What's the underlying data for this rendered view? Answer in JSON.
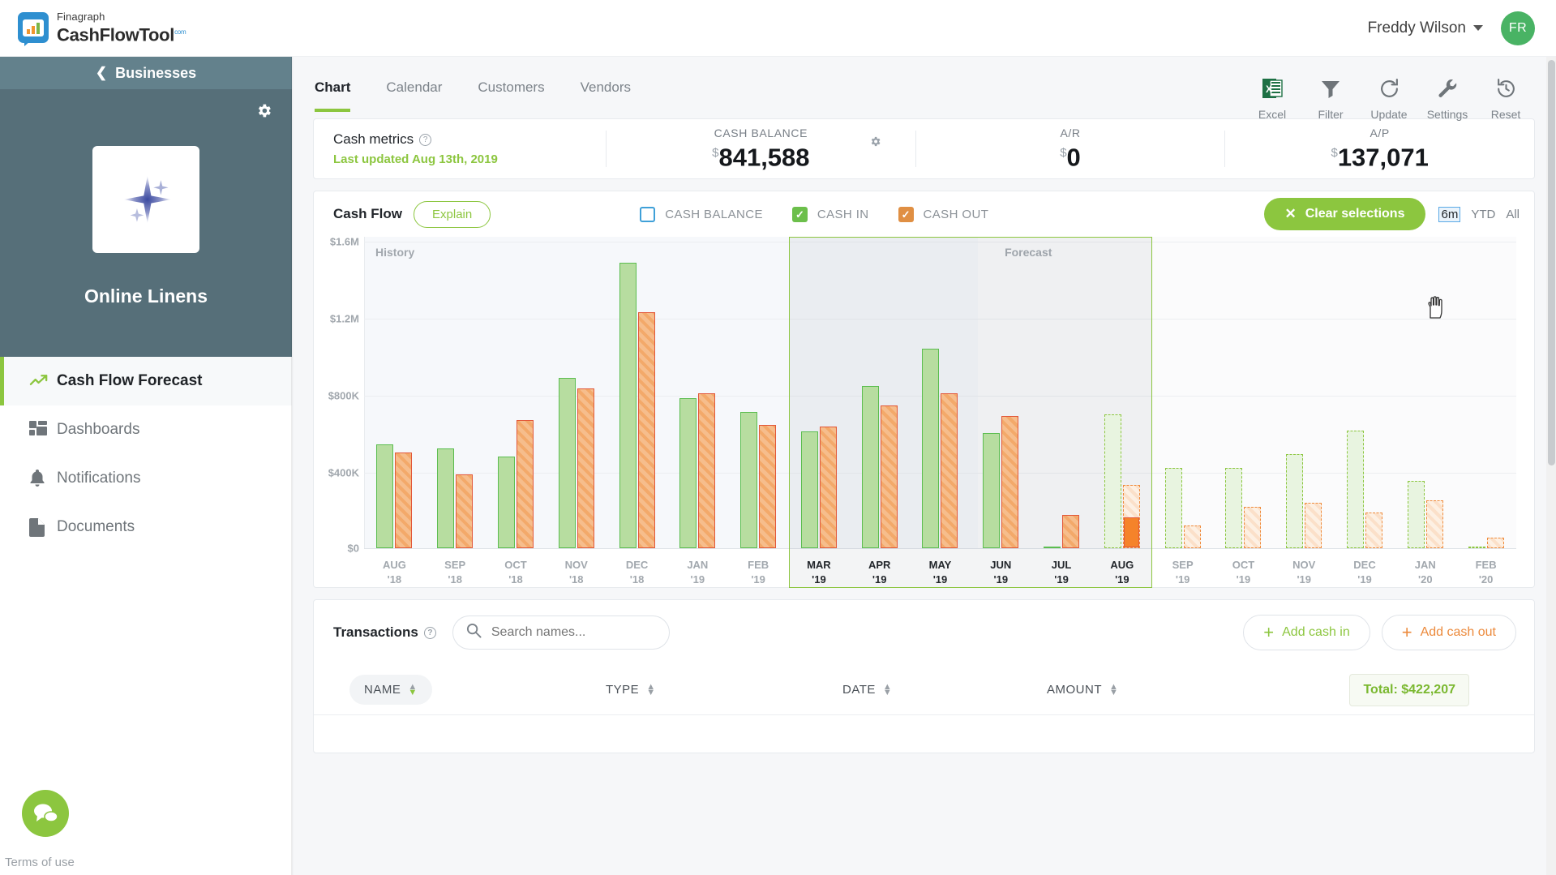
{
  "topbar": {
    "logo_top": "Finagraph",
    "logo_main": "CashFlowTool",
    "logo_sup": "com",
    "user_name": "Freddy Wilson",
    "avatar_initials": "FR"
  },
  "sidebar": {
    "businesses_label": "Businesses",
    "business_name": "Online Linens",
    "items": [
      {
        "label": "Cash Flow Forecast",
        "icon": "trend-up-icon",
        "active": true
      },
      {
        "label": "Dashboards",
        "icon": "dashboard-grid-icon",
        "active": false
      },
      {
        "label": "Notifications",
        "icon": "bell-icon",
        "active": false
      },
      {
        "label": "Documents",
        "icon": "document-icon",
        "active": false
      }
    ],
    "terms_label": "Terms of use"
  },
  "tabs": [
    {
      "label": "Chart",
      "active": true
    },
    {
      "label": "Calendar",
      "active": false
    },
    {
      "label": "Customers",
      "active": false
    },
    {
      "label": "Vendors",
      "active": false
    }
  ],
  "toolbar": [
    {
      "label": "Excel",
      "icon": "excel-icon"
    },
    {
      "label": "Filter",
      "icon": "funnel-icon"
    },
    {
      "label": "Update",
      "icon": "refresh-icon"
    },
    {
      "label": "Settings",
      "icon": "wrench-icon"
    },
    {
      "label": "Reset",
      "icon": "history-icon"
    }
  ],
  "metrics": {
    "title": "Cash metrics",
    "last_updated": "Last updated Aug 13th, 2019",
    "cards": [
      {
        "label": "CASH BALANCE",
        "currency": "$",
        "value": "841,588"
      },
      {
        "label": "A/R",
        "currency": "$",
        "value": "0"
      },
      {
        "label": "A/P",
        "currency": "$",
        "value": "137,071"
      }
    ]
  },
  "cashflow": {
    "title": "Cash Flow",
    "explain_label": "Explain",
    "legend": [
      {
        "label": "CASH BALANCE",
        "checked": false,
        "color": "#3fa0d8"
      },
      {
        "label": "CASH IN",
        "checked": true,
        "color": "#6cbf4b"
      },
      {
        "label": "CASH OUT",
        "checked": true,
        "color": "#e08f43"
      }
    ],
    "clear_label": "Clear selections",
    "ranges": [
      {
        "label": "6m",
        "selected": true
      },
      {
        "label": "YTD",
        "selected": false
      },
      {
        "label": "All",
        "selected": false
      }
    ],
    "history_label": "History",
    "forecast_label": "Forecast"
  },
  "chart_data": {
    "type": "bar",
    "title": "Cash Flow",
    "xlabel": "",
    "ylabel": "",
    "ylim": [
      0,
      1600000
    ],
    "yticks": [
      0,
      400000,
      800000,
      1200000,
      1600000
    ],
    "ytick_labels": [
      "$0",
      "$400K",
      "$800K",
      "$1.2M",
      "$1.6M"
    ],
    "grid": true,
    "legend_position": "top",
    "categories": [
      "AUG '18",
      "SEP '18",
      "OCT '18",
      "NOV '18",
      "DEC '18",
      "JAN '19",
      "FEB '19",
      "MAR '19",
      "APR '19",
      "MAY '19",
      "JUN '19",
      "JUL '19",
      "AUG '19",
      "SEP '19",
      "OCT '19",
      "NOV '19",
      "DEC '19",
      "JAN '20",
      "FEB '20"
    ],
    "forecast_start_index": 12,
    "selection_range": [
      "MAR '19",
      "AUG '19"
    ],
    "series": [
      {
        "name": "CASH IN",
        "color": "#b7dda0",
        "values": [
          540000,
          520000,
          480000,
          890000,
          1490000,
          785000,
          710000,
          610000,
          845000,
          1040000,
          600000,
          8000,
          700000,
          420000,
          420000,
          490000,
          615000,
          350000,
          6000
        ]
      },
      {
        "name": "CASH OUT",
        "color": "#f3a96a",
        "values": [
          500000,
          385000,
          670000,
          835000,
          1230000,
          810000,
          645000,
          635000,
          745000,
          810000,
          690000,
          175000,
          330000,
          120000,
          215000,
          235000,
          185000,
          250000,
          55000
        ]
      }
    ]
  },
  "transactions": {
    "title": "Transactions",
    "search_placeholder": "Search names...",
    "search_value": "",
    "add_cash_in_label": "Add cash in",
    "add_cash_out_label": "Add cash out",
    "columns": [
      "NAME",
      "TYPE",
      "DATE",
      "AMOUNT"
    ],
    "total_label": "Total: $422,207"
  },
  "colors": {
    "accent_green": "#8cc63f",
    "cash_in": "#6cbf4b",
    "cash_out": "#e08f43",
    "sidebar_dark": "#566f79",
    "sidebar_header": "#63818c"
  }
}
